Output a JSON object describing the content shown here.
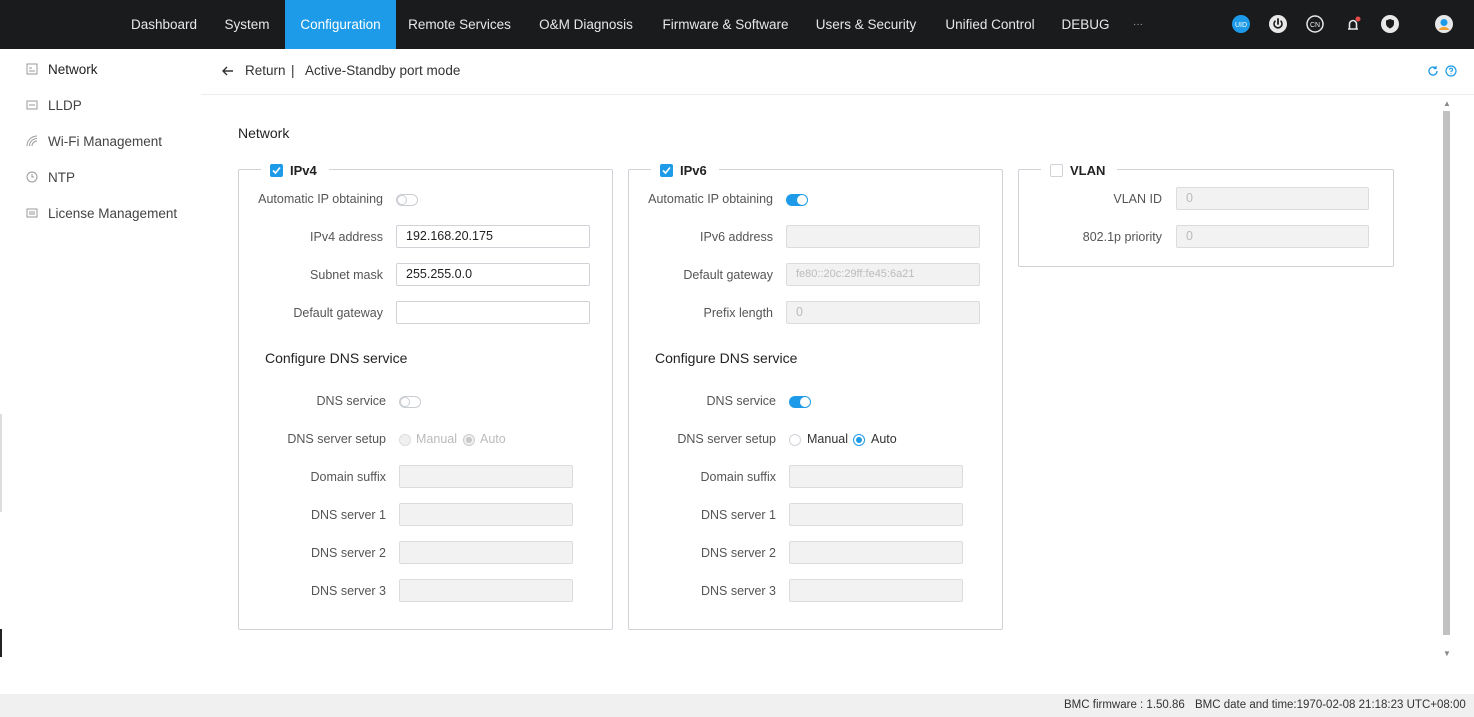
{
  "nav": {
    "items": [
      "Dashboard",
      "System",
      "Configuration",
      "Remote Services",
      "O&M Diagnosis",
      "Firmware & Software",
      "Users & Security",
      "Unified Control",
      "DEBUG",
      "···"
    ],
    "active": "Configuration",
    "icons": [
      "uid-icon",
      "power-icon",
      "language-icon",
      "alarm-bell-icon",
      "security-shield-icon",
      "user-avatar-icon"
    ],
    "uid_label": "UID",
    "lang_label": "CN"
  },
  "sidebar": {
    "items": [
      {
        "label": "Network",
        "icon": "network-icon"
      },
      {
        "label": "LLDP",
        "icon": "lldp-icon"
      },
      {
        "label": "Wi-Fi Management",
        "icon": "wifi-icon"
      },
      {
        "label": "NTP",
        "icon": "ntp-icon"
      },
      {
        "label": "License Management",
        "icon": "license-icon"
      }
    ]
  },
  "header": {
    "return_label": "Return",
    "separator": "|",
    "title": "Active-Standby port mode"
  },
  "section_title": "Network",
  "ipv4": {
    "legend": "IPv4",
    "checked": true,
    "auto_ip_label": "Automatic IP obtaining",
    "auto_ip_on": false,
    "address_label": "IPv4 address",
    "address_value": "192.168.20.175",
    "mask_label": "Subnet mask",
    "mask_value": "255.255.0.0",
    "gateway_label": "Default gateway",
    "gateway_value": "",
    "dns_heading": "Configure DNS service",
    "dns_service_label": "DNS service",
    "dns_service_on": false,
    "dns_setup_label": "DNS server setup",
    "manual_label": "Manual",
    "auto_label": "Auto",
    "domain_label": "Domain suffix",
    "dns1_label": "DNS server 1",
    "dns2_label": "DNS server 2",
    "dns3_label": "DNS server 3"
  },
  "ipv6": {
    "legend": "IPv6",
    "checked": true,
    "auto_ip_label": "Automatic IP obtaining",
    "auto_ip_on": true,
    "address_label": "IPv6 address",
    "address_value": "",
    "gateway_label": "Default gateway",
    "gateway_value": "fe80::20c:29ff:fe45:6a21",
    "prefix_label": "Prefix length",
    "prefix_value": "0",
    "dns_heading": "Configure DNS service",
    "dns_service_label": "DNS service",
    "dns_service_on": true,
    "dns_setup_label": "DNS server setup",
    "manual_label": "Manual",
    "auto_label": "Auto",
    "domain_label": "Domain suffix",
    "dns1_label": "DNS server 1",
    "dns2_label": "DNS server 2",
    "dns3_label": "DNS server 3"
  },
  "vlan": {
    "legend": "VLAN",
    "checked": false,
    "id_label": "VLAN ID",
    "id_value": "0",
    "priority_label": "802.1p priority",
    "priority_value": "0"
  },
  "footer": {
    "firmware": "BMC firmware : 1.50.86",
    "datetime": "BMC date and time:1970-02-08 21:18:23 UTC+08:00"
  },
  "colors": {
    "accent": "#1e9be8",
    "nav_bg": "#1a1b1d"
  }
}
